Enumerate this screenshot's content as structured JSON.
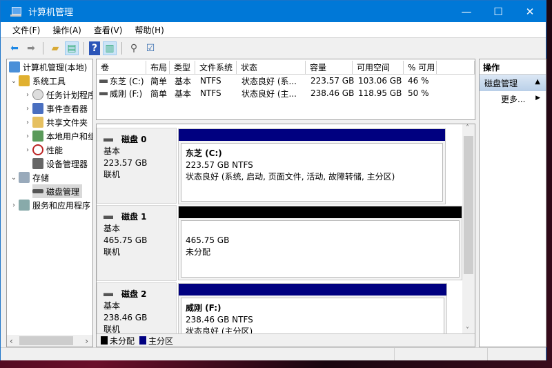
{
  "window": {
    "title": "计算机管理",
    "minimize": "—",
    "maximize": "☐",
    "close": "✕"
  },
  "menu": [
    "文件(F)",
    "操作(A)",
    "查看(V)",
    "帮助(H)"
  ],
  "tree": {
    "root": "计算机管理(本地)",
    "system_tools": "系统工具",
    "task_scheduler": "任务计划程序",
    "event_viewer": "事件查看器",
    "shared_folders": "共享文件夹",
    "local_users": "本地用户和组",
    "performance": "性能",
    "device_manager": "设备管理器",
    "storage": "存储",
    "disk_management": "磁盘管理",
    "services_apps": "服务和应用程序"
  },
  "volume_list": {
    "columns": [
      "卷",
      "布局",
      "类型",
      "文件系统",
      "状态",
      "容量",
      "可用空间",
      "% 可用"
    ],
    "rows": [
      [
        "东芝 (C:)",
        "简单",
        "基本",
        "NTFS",
        "状态良好 (系...",
        "223.57 GB",
        "103.06 GB",
        "46 %"
      ],
      [
        "威刚 (F:)",
        "简单",
        "基本",
        "NTFS",
        "状态良好 (主...",
        "238.46 GB",
        "118.95 GB",
        "50 %"
      ]
    ]
  },
  "disks": [
    {
      "name": "磁盘 0",
      "type": "基本",
      "size": "223.57 GB",
      "state": "联机",
      "partition": {
        "label": "东芝  (C:)",
        "size": "223.57 GB NTFS",
        "status": "状态良好 (系统, 启动, 页面文件, 活动, 故障转储, 主分区)",
        "color": "#000080"
      }
    },
    {
      "name": "磁盘 1",
      "type": "基本",
      "size": "465.75 GB",
      "state": "联机",
      "partition": {
        "label": "",
        "size": "465.75 GB",
        "status": "未分配",
        "color": "#000000"
      }
    },
    {
      "name": "磁盘 2",
      "type": "基本",
      "size": "238.46 GB",
      "state": "联机",
      "partition": {
        "label": "威刚  (F:)",
        "size": "238.46 GB NTFS",
        "status": "状态良好 (主分区)",
        "color": "#000080"
      }
    }
  ],
  "legend": [
    {
      "label": "未分配",
      "color": "#000000"
    },
    {
      "label": "主分区",
      "color": "#000080"
    }
  ],
  "actions": {
    "header": "操作",
    "section": "磁盘管理",
    "more": "更多..."
  }
}
